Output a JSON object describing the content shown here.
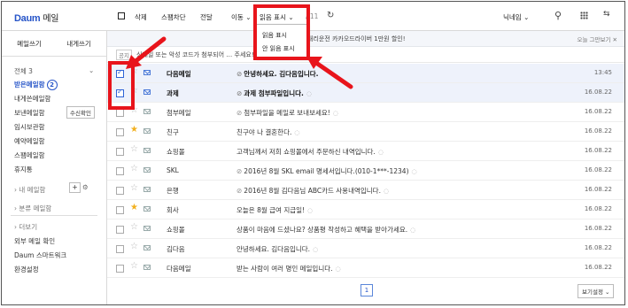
{
  "app": {
    "logo": "Daum",
    "title": "메일"
  },
  "toolbar": {
    "delete": "삭제",
    "spam": "스팸차단",
    "forward": "전달",
    "move": "이동",
    "read_display": "읽음 표시",
    "page_info": "/ 11",
    "nickname": "닉네임"
  },
  "dropdown": {
    "options": [
      "읽음 표시",
      "안 읽음 표시"
    ]
  },
  "sidebar": {
    "write": "메일쓰기",
    "write_to_me": "내게쓰기",
    "all_label": "전체 3",
    "folders": [
      {
        "label": "받은메일함",
        "badge": "2"
      },
      {
        "label": "내게쓴메일함"
      },
      {
        "label": "보낸메일함",
        "button": "수신확인"
      },
      {
        "label": "임시보관함"
      },
      {
        "label": "예약메일함"
      },
      {
        "label": "스팸메일함"
      },
      {
        "label": "휴지통"
      }
    ],
    "my_mailbox": "내 메일함",
    "category_mailbox": "분류 메일함",
    "more": "더보기",
    "extras": [
      "외부 메일 확인",
      "Daum 스마트워크",
      "환경설정"
    ]
  },
  "ad": {
    "text": "대리운전 카카오드라이버 1만원 할인!",
    "close": "오늘 그만보기 ✕"
  },
  "notice": {
    "tag": "공지",
    "text": "싱메일 또는 악성 코드가 첨부되어 … 주세요!"
  },
  "mails": [
    {
      "sender": "다음메일",
      "subject": "안녕하세요. 김다음입니다.",
      "date": "13:45",
      "unread": true,
      "selected": true,
      "starred": false,
      "attach": true,
      "reply": false
    },
    {
      "sender": "과제",
      "subject": "과제 첨부파일입니다.",
      "date": "16.08.22",
      "unread": true,
      "selected": true,
      "starred": false,
      "attach": true,
      "reply": true
    },
    {
      "sender": "첨부메일",
      "subject": "첨부파일을 메일로 보내보세요!",
      "date": "16.08.22",
      "unread": false,
      "selected": false,
      "starred": false,
      "attach": true,
      "reply": true
    },
    {
      "sender": "친구",
      "subject": "친구야 나 결혼한다.",
      "date": "16.08.22",
      "unread": false,
      "selected": false,
      "starred": true,
      "attach": false,
      "reply": true
    },
    {
      "sender": "쇼핑몰",
      "subject": "고객님께서 저희 쇼핑몰에서 주문하신 내역입니다.",
      "date": "16.08.22",
      "unread": false,
      "selected": false,
      "starred": false,
      "attach": false,
      "reply": true
    },
    {
      "sender": "SKL",
      "subject": "2016년 8월 SKL email 명세서입니다.(010-1***-1234)",
      "date": "16.08.22",
      "unread": false,
      "selected": false,
      "starred": false,
      "attach": true,
      "reply": true
    },
    {
      "sender": "은행",
      "subject": "2016년 8월 김다음님 ABC카드 사용내역입니다.",
      "date": "16.08.22",
      "unread": false,
      "selected": false,
      "starred": false,
      "attach": true,
      "reply": true
    },
    {
      "sender": "회사",
      "subject": "오늘은 8월 급여 지급일!",
      "date": "16.08.22",
      "unread": false,
      "selected": false,
      "starred": true,
      "attach": false,
      "reply": true
    },
    {
      "sender": "쇼핑몰",
      "subject": "상품이 마음에 드셨나요? 상품평 작성하고 혜택을 받아가세요.",
      "date": "16.08.22",
      "unread": false,
      "selected": false,
      "starred": false,
      "attach": false,
      "reply": true
    },
    {
      "sender": "김다음",
      "subject": "안녕하세요. 김다음입니다.",
      "date": "16.08.22",
      "unread": false,
      "selected": false,
      "starred": false,
      "attach": false,
      "reply": true
    },
    {
      "sender": "다음메일",
      "subject": "받는 사람이 여러 명인 메일입니다.",
      "date": "16.08.22",
      "unread": false,
      "selected": false,
      "starred": false,
      "attach": false,
      "reply": true
    }
  ],
  "pagination": {
    "current": "1"
  },
  "view_settings": "보기설정 ⌄",
  "highlight_color": "#e8141b",
  "accent_color": "#2755c8"
}
